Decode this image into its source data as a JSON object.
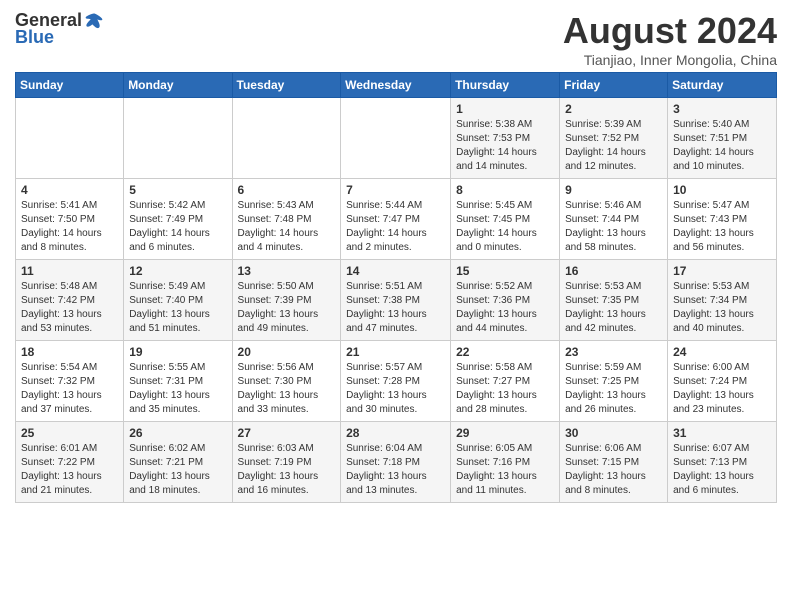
{
  "header": {
    "logo_general": "General",
    "logo_blue": "Blue",
    "title": "August 2024",
    "subtitle": "Tianjiao, Inner Mongolia, China"
  },
  "calendar": {
    "weekdays": [
      "Sunday",
      "Monday",
      "Tuesday",
      "Wednesday",
      "Thursday",
      "Friday",
      "Saturday"
    ],
    "weeks": [
      [
        {
          "day": "",
          "info": ""
        },
        {
          "day": "",
          "info": ""
        },
        {
          "day": "",
          "info": ""
        },
        {
          "day": "",
          "info": ""
        },
        {
          "day": "1",
          "info": "Sunrise: 5:38 AM\nSunset: 7:53 PM\nDaylight: 14 hours\nand 14 minutes."
        },
        {
          "day": "2",
          "info": "Sunrise: 5:39 AM\nSunset: 7:52 PM\nDaylight: 14 hours\nand 12 minutes."
        },
        {
          "day": "3",
          "info": "Sunrise: 5:40 AM\nSunset: 7:51 PM\nDaylight: 14 hours\nand 10 minutes."
        }
      ],
      [
        {
          "day": "4",
          "info": "Sunrise: 5:41 AM\nSunset: 7:50 PM\nDaylight: 14 hours\nand 8 minutes."
        },
        {
          "day": "5",
          "info": "Sunrise: 5:42 AM\nSunset: 7:49 PM\nDaylight: 14 hours\nand 6 minutes."
        },
        {
          "day": "6",
          "info": "Sunrise: 5:43 AM\nSunset: 7:48 PM\nDaylight: 14 hours\nand 4 minutes."
        },
        {
          "day": "7",
          "info": "Sunrise: 5:44 AM\nSunset: 7:47 PM\nDaylight: 14 hours\nand 2 minutes."
        },
        {
          "day": "8",
          "info": "Sunrise: 5:45 AM\nSunset: 7:45 PM\nDaylight: 14 hours\nand 0 minutes."
        },
        {
          "day": "9",
          "info": "Sunrise: 5:46 AM\nSunset: 7:44 PM\nDaylight: 13 hours\nand 58 minutes."
        },
        {
          "day": "10",
          "info": "Sunrise: 5:47 AM\nSunset: 7:43 PM\nDaylight: 13 hours\nand 56 minutes."
        }
      ],
      [
        {
          "day": "11",
          "info": "Sunrise: 5:48 AM\nSunset: 7:42 PM\nDaylight: 13 hours\nand 53 minutes."
        },
        {
          "day": "12",
          "info": "Sunrise: 5:49 AM\nSunset: 7:40 PM\nDaylight: 13 hours\nand 51 minutes."
        },
        {
          "day": "13",
          "info": "Sunrise: 5:50 AM\nSunset: 7:39 PM\nDaylight: 13 hours\nand 49 minutes."
        },
        {
          "day": "14",
          "info": "Sunrise: 5:51 AM\nSunset: 7:38 PM\nDaylight: 13 hours\nand 47 minutes."
        },
        {
          "day": "15",
          "info": "Sunrise: 5:52 AM\nSunset: 7:36 PM\nDaylight: 13 hours\nand 44 minutes."
        },
        {
          "day": "16",
          "info": "Sunrise: 5:53 AM\nSunset: 7:35 PM\nDaylight: 13 hours\nand 42 minutes."
        },
        {
          "day": "17",
          "info": "Sunrise: 5:53 AM\nSunset: 7:34 PM\nDaylight: 13 hours\nand 40 minutes."
        }
      ],
      [
        {
          "day": "18",
          "info": "Sunrise: 5:54 AM\nSunset: 7:32 PM\nDaylight: 13 hours\nand 37 minutes."
        },
        {
          "day": "19",
          "info": "Sunrise: 5:55 AM\nSunset: 7:31 PM\nDaylight: 13 hours\nand 35 minutes."
        },
        {
          "day": "20",
          "info": "Sunrise: 5:56 AM\nSunset: 7:30 PM\nDaylight: 13 hours\nand 33 minutes."
        },
        {
          "day": "21",
          "info": "Sunrise: 5:57 AM\nSunset: 7:28 PM\nDaylight: 13 hours\nand 30 minutes."
        },
        {
          "day": "22",
          "info": "Sunrise: 5:58 AM\nSunset: 7:27 PM\nDaylight: 13 hours\nand 28 minutes."
        },
        {
          "day": "23",
          "info": "Sunrise: 5:59 AM\nSunset: 7:25 PM\nDaylight: 13 hours\nand 26 minutes."
        },
        {
          "day": "24",
          "info": "Sunrise: 6:00 AM\nSunset: 7:24 PM\nDaylight: 13 hours\nand 23 minutes."
        }
      ],
      [
        {
          "day": "25",
          "info": "Sunrise: 6:01 AM\nSunset: 7:22 PM\nDaylight: 13 hours\nand 21 minutes."
        },
        {
          "day": "26",
          "info": "Sunrise: 6:02 AM\nSunset: 7:21 PM\nDaylight: 13 hours\nand 18 minutes."
        },
        {
          "day": "27",
          "info": "Sunrise: 6:03 AM\nSunset: 7:19 PM\nDaylight: 13 hours\nand 16 minutes."
        },
        {
          "day": "28",
          "info": "Sunrise: 6:04 AM\nSunset: 7:18 PM\nDaylight: 13 hours\nand 13 minutes."
        },
        {
          "day": "29",
          "info": "Sunrise: 6:05 AM\nSunset: 7:16 PM\nDaylight: 13 hours\nand 11 minutes."
        },
        {
          "day": "30",
          "info": "Sunrise: 6:06 AM\nSunset: 7:15 PM\nDaylight: 13 hours\nand 8 minutes."
        },
        {
          "day": "31",
          "info": "Sunrise: 6:07 AM\nSunset: 7:13 PM\nDaylight: 13 hours\nand 6 minutes."
        }
      ]
    ]
  }
}
